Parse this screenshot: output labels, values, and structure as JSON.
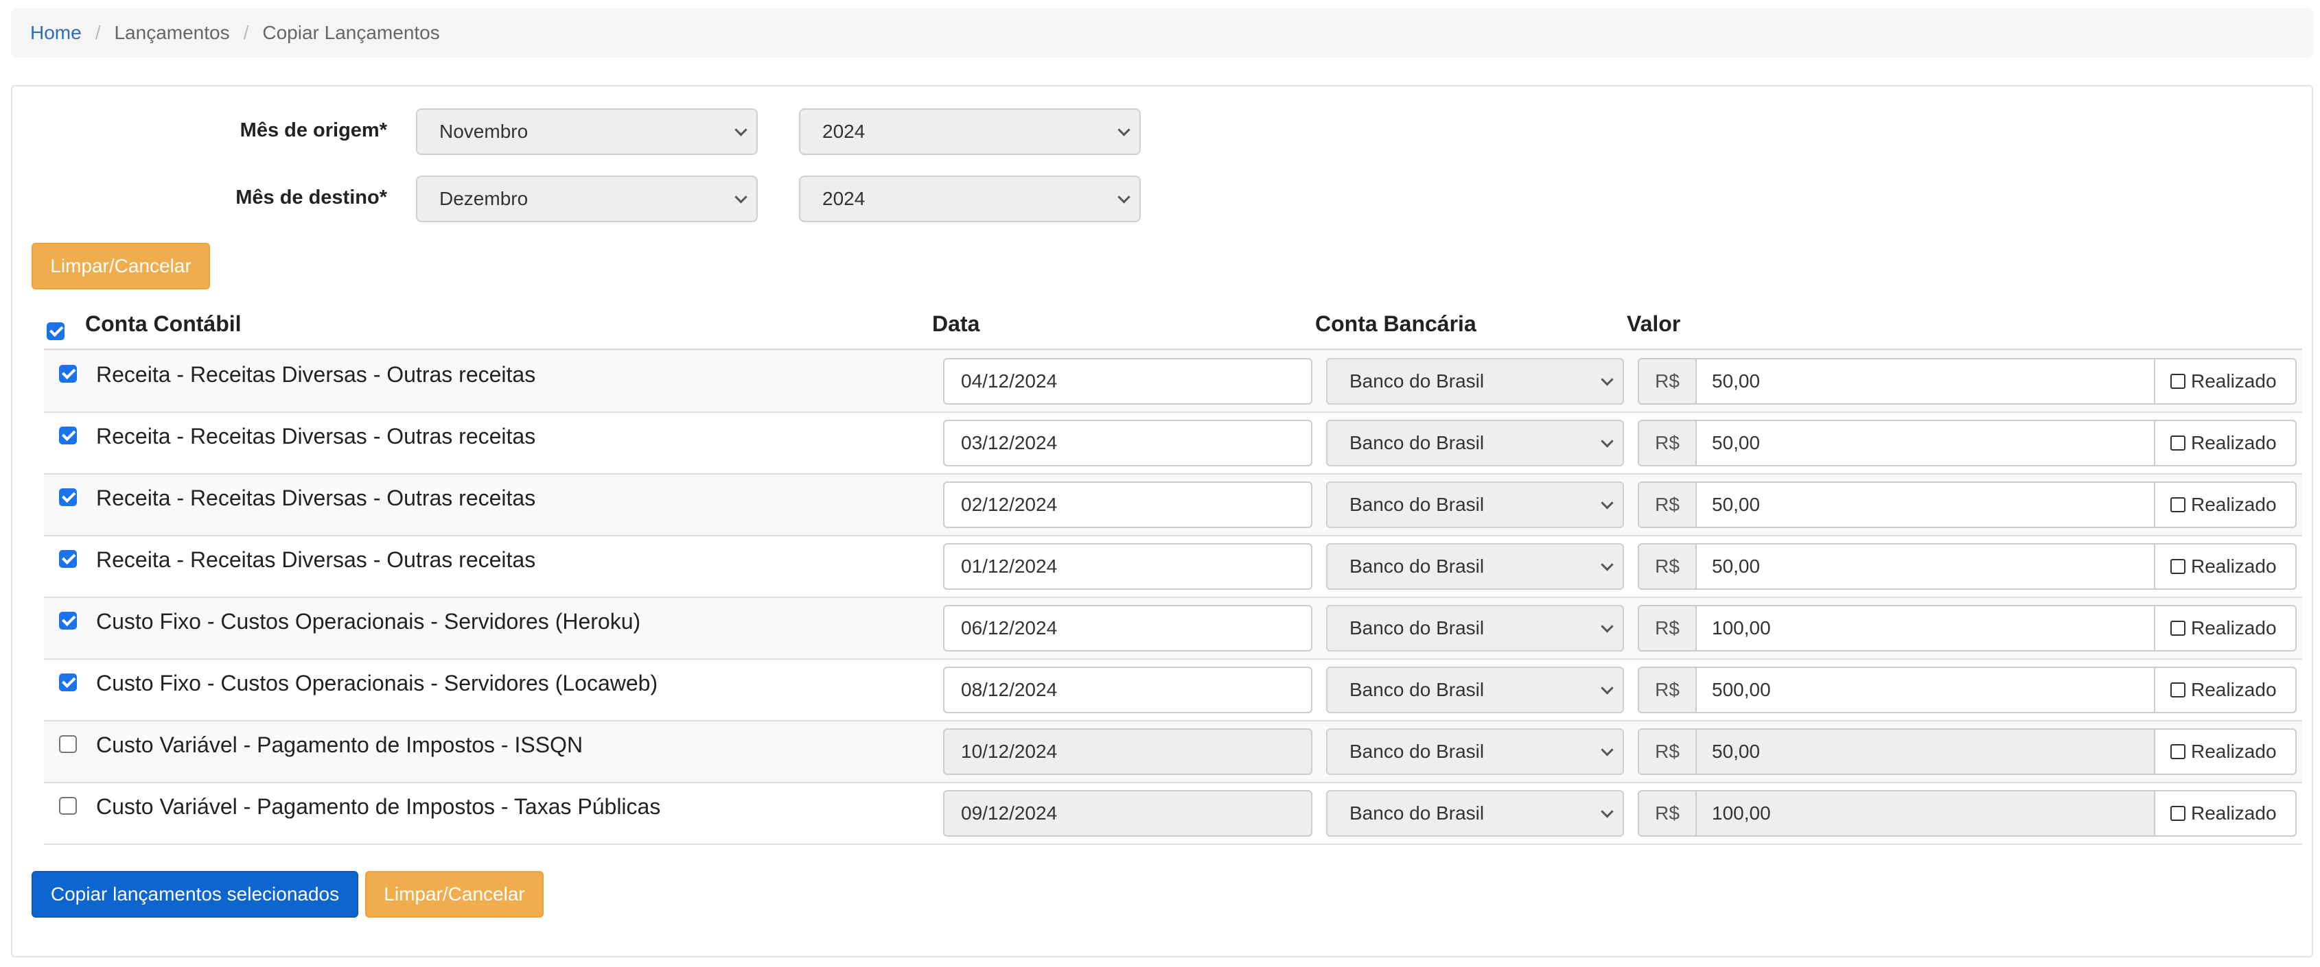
{
  "breadcrumb": {
    "home": "Home",
    "section": "Lançamentos",
    "current": "Copiar Lançamentos"
  },
  "form": {
    "origin_label": "Mês de origem*",
    "origin_month": "Novembro",
    "origin_year": "2024",
    "dest_label": "Mês de destino*",
    "dest_month": "Dezembro",
    "dest_year": "2024",
    "clear_label": "Limpar/Cancelar"
  },
  "table": {
    "headers": {
      "account": "Conta Contábil",
      "date": "Data",
      "bank": "Conta Bancária",
      "value": "Valor"
    },
    "currency": "R$",
    "realized_label": "Realizado",
    "rows": [
      {
        "account": "Receita - Receitas Diversas - Outras receitas",
        "date": "04/12/2024",
        "bank": "Banco do Brasil",
        "value": "50,00",
        "checked": true
      },
      {
        "account": "Receita - Receitas Diversas - Outras receitas",
        "date": "03/12/2024",
        "bank": "Banco do Brasil",
        "value": "50,00",
        "checked": true
      },
      {
        "account": "Receita - Receitas Diversas - Outras receitas",
        "date": "02/12/2024",
        "bank": "Banco do Brasil",
        "value": "50,00",
        "checked": true
      },
      {
        "account": "Receita - Receitas Diversas - Outras receitas",
        "date": "01/12/2024",
        "bank": "Banco do Brasil",
        "value": "50,00",
        "checked": true
      },
      {
        "account": "Custo Fixo - Custos Operacionais - Servidores (Heroku)",
        "date": "06/12/2024",
        "bank": "Banco do Brasil",
        "value": "100,00",
        "checked": true
      },
      {
        "account": "Custo Fixo - Custos Operacionais - Servidores (Locaweb)",
        "date": "08/12/2024",
        "bank": "Banco do Brasil",
        "value": "500,00",
        "checked": true
      },
      {
        "account": "Custo Variável - Pagamento de Impostos - ISSQN",
        "date": "10/12/2024",
        "bank": "Banco do Brasil",
        "value": "50,00",
        "checked": false
      },
      {
        "account": "Custo Variável - Pagamento de Impostos - Taxas Públicas",
        "date": "09/12/2024",
        "bank": "Banco do Brasil",
        "value": "100,00",
        "checked": false
      }
    ]
  },
  "actions": {
    "copy_label": "Copiar lançamentos selecionados",
    "clear_label": "Limpar/Cancelar"
  },
  "colors": {
    "primary": "#0d66d0",
    "warning": "#f0ad4e",
    "checkbox": "#1a73e8",
    "link": "#2a6fb8"
  }
}
